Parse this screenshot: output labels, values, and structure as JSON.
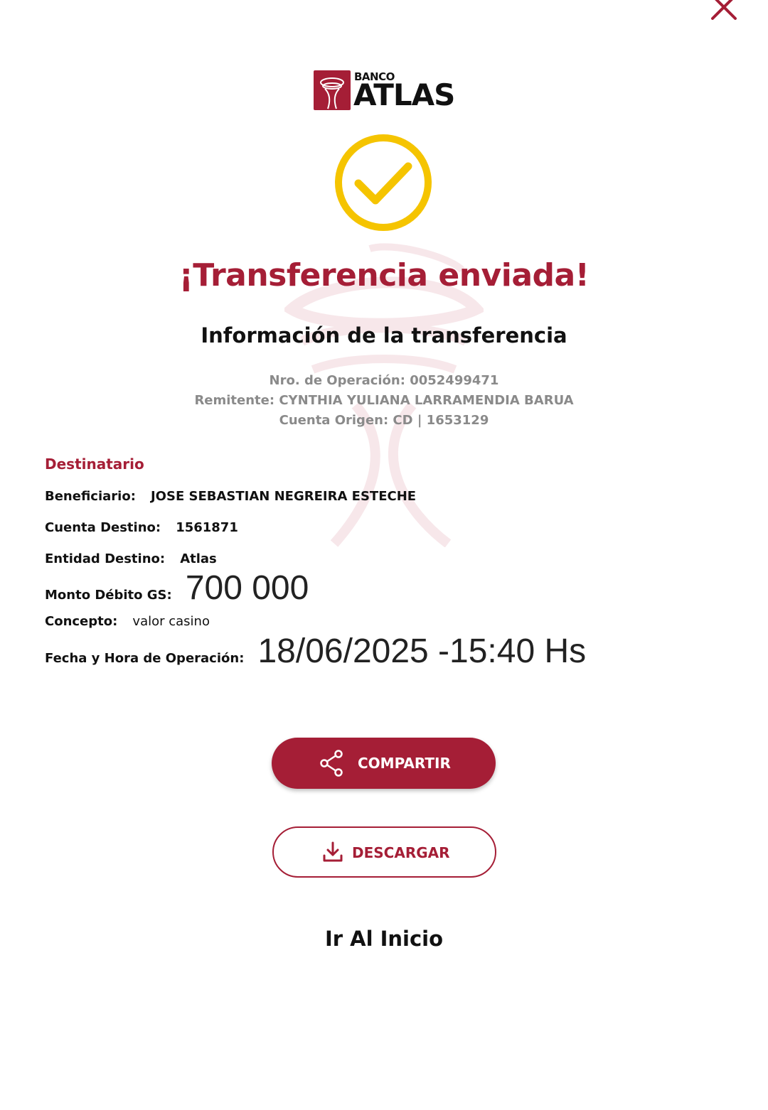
{
  "brand": {
    "small": "BANCO",
    "name": "ATLAS",
    "color": "#a51e36",
    "accent": "#f5c400"
  },
  "title": "¡Transferencia enviada!",
  "subtitle": "Información de la transferencia",
  "info": {
    "operation": "Nro. de Operación: 0052499471",
    "sender": "Remitente: CYNTHIA YULIANA LARRAMENDIA BARUA",
    "origin_account": "Cuenta Origen: CD | 1653129"
  },
  "recipient": {
    "section_title": "Destinatario",
    "rows": [
      {
        "label": "Beneficiario:",
        "value": "JOSE SEBASTIAN NEGREIRA ESTECHE"
      },
      {
        "label": "Cuenta Destino:",
        "value": "1561871"
      },
      {
        "label": "Entidad Destino:",
        "value": "Atlas"
      },
      {
        "label": "Monto Débito GS:",
        "value": "700 000"
      },
      {
        "label": "Concepto:",
        "value": "valor casino"
      },
      {
        "label": "Fecha y Hora de Operación:",
        "value": "18/06/2025 -15:40 Hs"
      }
    ]
  },
  "actions": {
    "share": "COMPARTIR",
    "download": "DESCARGAR",
    "home": "Ir Al Inicio"
  },
  "icons": {
    "close": "close-icon",
    "check": "check-circle-icon",
    "share": "share-icon",
    "download": "download-icon"
  }
}
